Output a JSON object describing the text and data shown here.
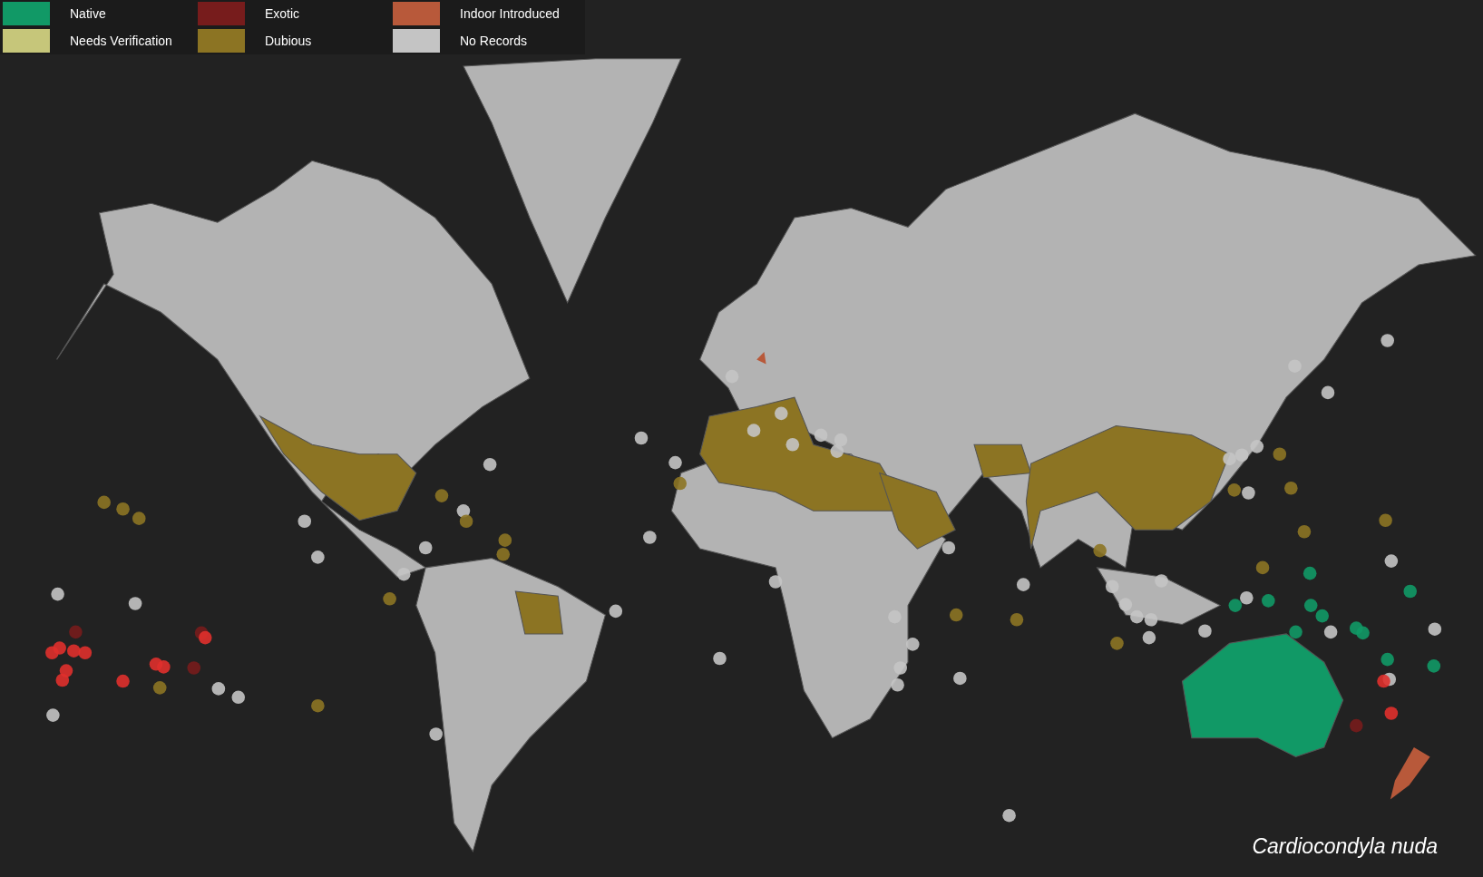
{
  "legend": [
    {
      "label": "Native",
      "color": "#119966"
    },
    {
      "label": "Exotic",
      "color": "#771c1c"
    },
    {
      "label": "Indoor Introduced",
      "color": "#b8593a"
    },
    {
      "label": "Needs Verification",
      "color": "#c6c67a"
    },
    {
      "label": "Dubious",
      "color": "#8c7423"
    },
    {
      "label": "No Records",
      "color": "#c4c4c4"
    }
  ],
  "species": "Cardiocondyla nuda"
}
